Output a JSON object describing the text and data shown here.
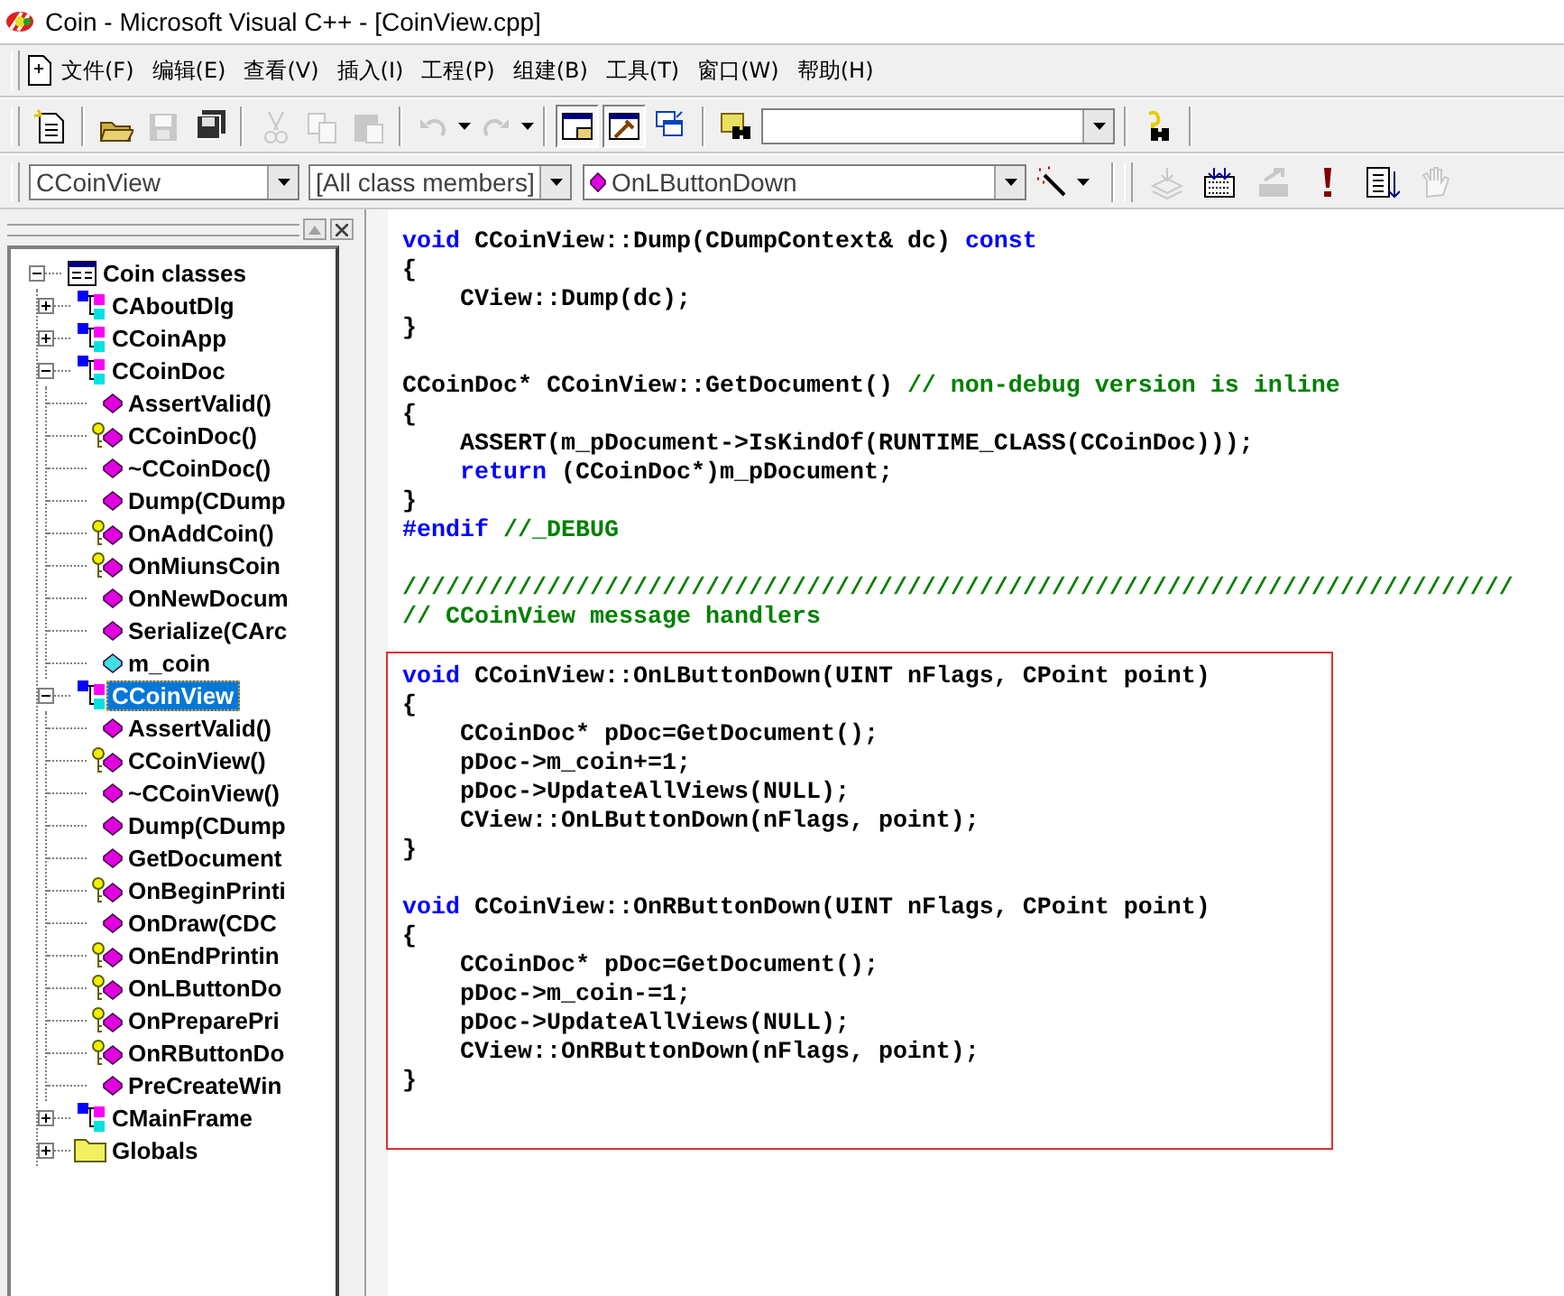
{
  "window": {
    "title": "Coin - Microsoft Visual C++ - [CoinView.cpp]"
  },
  "menu": [
    {
      "label": "文件(F)"
    },
    {
      "label": "编辑(E)"
    },
    {
      "label": "查看(V)"
    },
    {
      "label": "插入(I)"
    },
    {
      "label": "工程(P)"
    },
    {
      "label": "组建(B)"
    },
    {
      "label": "工具(T)"
    },
    {
      "label": "窗口(W)"
    },
    {
      "label": "帮助(H)"
    }
  ],
  "toolbar": [
    {
      "kind": "new",
      "disabled": false,
      "pressed": false
    },
    {
      "kind": "sep"
    },
    {
      "kind": "open",
      "disabled": false,
      "pressed": false
    },
    {
      "kind": "save",
      "disabled": true,
      "pressed": false
    },
    {
      "kind": "saveall",
      "disabled": false,
      "pressed": false
    },
    {
      "kind": "sep"
    },
    {
      "kind": "cut",
      "disabled": true,
      "pressed": false
    },
    {
      "kind": "copy",
      "disabled": true,
      "pressed": false
    },
    {
      "kind": "paste",
      "disabled": true,
      "pressed": false
    },
    {
      "kind": "sep"
    },
    {
      "kind": "undo",
      "disabled": true,
      "pressed": false
    },
    {
      "kind": "redo",
      "disabled": true,
      "pressed": false
    },
    {
      "kind": "sep"
    },
    {
      "kind": "workspace",
      "disabled": false,
      "pressed": true
    },
    {
      "kind": "output",
      "disabled": false,
      "pressed": true
    },
    {
      "kind": "windows",
      "disabled": false,
      "pressed": false
    },
    {
      "kind": "sep"
    },
    {
      "kind": "findfiles",
      "disabled": false,
      "pressed": false
    },
    {
      "kind": "combo"
    },
    {
      "kind": "sep"
    },
    {
      "kind": "helpfind",
      "disabled": false,
      "pressed": false
    }
  ],
  "wizard_bar": {
    "class_combo": "CCoinView",
    "filter_combo": "[All class members]",
    "member_combo": "OnLButtonDown"
  },
  "build_toolbar": [
    {
      "kind": "compile",
      "disabled": true
    },
    {
      "kind": "build",
      "disabled": false
    },
    {
      "kind": "stop",
      "disabled": true
    },
    {
      "kind": "execute",
      "disabled": false
    },
    {
      "kind": "go",
      "disabled": false
    },
    {
      "kind": "breakpoint",
      "disabled": true
    }
  ],
  "class_tree": {
    "children": [
      {
        "label": "Coin classes",
        "kind": "classes",
        "expanded": true,
        "selected": false,
        "children": [
          {
            "label": "CAboutDlg",
            "kind": "class",
            "expanded": false,
            "selected": false
          },
          {
            "label": "CCoinApp",
            "kind": "class",
            "expanded": false,
            "selected": false
          },
          {
            "label": "CCoinDoc",
            "kind": "class",
            "expanded": true,
            "selected": false,
            "children": [
              {
                "label": "AssertValid()",
                "kind": "method",
                "selected": false
              },
              {
                "label": "CCoinDoc()",
                "kind": "protected",
                "selected": false
              },
              {
                "label": "~CCoinDoc()",
                "kind": "method",
                "selected": false
              },
              {
                "label": "Dump(CDump",
                "kind": "method",
                "selected": false
              },
              {
                "label": "OnAddCoin()",
                "kind": "protected",
                "selected": false
              },
              {
                "label": "OnMiunsCoin",
                "kind": "protected",
                "selected": false
              },
              {
                "label": "OnNewDocum",
                "kind": "method",
                "selected": false
              },
              {
                "label": "Serialize(CArc",
                "kind": "method",
                "selected": false
              },
              {
                "label": "m_coin",
                "kind": "variable",
                "selected": false
              }
            ]
          },
          {
            "label": "CCoinView",
            "kind": "class",
            "expanded": true,
            "selected": true,
            "children": [
              {
                "label": "AssertValid()",
                "kind": "method",
                "selected": false
              },
              {
                "label": "CCoinView()",
                "kind": "protected",
                "selected": false
              },
              {
                "label": "~CCoinView()",
                "kind": "method",
                "selected": false
              },
              {
                "label": "Dump(CDump",
                "kind": "method",
                "selected": false
              },
              {
                "label": "GetDocument",
                "kind": "method",
                "selected": false
              },
              {
                "label": "OnBeginPrinti",
                "kind": "protected",
                "selected": false
              },
              {
                "label": "OnDraw(CDC",
                "kind": "method",
                "selected": false
              },
              {
                "label": "OnEndPrintin",
                "kind": "protected",
                "selected": false
              },
              {
                "label": "OnLButtonDo",
                "kind": "protected",
                "selected": false
              },
              {
                "label": "OnPreparePri",
                "kind": "protected",
                "selected": false
              },
              {
                "label": "OnRButtonDo",
                "kind": "protected",
                "selected": false
              },
              {
                "label": "PreCreateWin",
                "kind": "method",
                "selected": false
              }
            ]
          },
          {
            "label": "CMainFrame",
            "kind": "class",
            "expanded": false,
            "selected": false
          },
          {
            "label": "Globals",
            "kind": "folder",
            "expanded": false,
            "selected": false
          }
        ]
      }
    ]
  },
  "editor": {
    "lines": [
      {
        "kind": "code",
        "segments": [
          {
            "kind": "keyword",
            "text": "void"
          },
          {
            "kind": "plain",
            "text": " CCoinView::Dump(CDumpContext& dc) "
          },
          {
            "kind": "keyword",
            "text": "const"
          }
        ]
      },
      {
        "kind": "code",
        "segments": [
          {
            "kind": "plain",
            "text": "{"
          }
        ]
      },
      {
        "kind": "code",
        "segments": [
          {
            "kind": "plain",
            "text": "    CView::Dump(dc);"
          }
        ]
      },
      {
        "kind": "code",
        "segments": [
          {
            "kind": "plain",
            "text": "}"
          }
        ]
      },
      {
        "kind": "blank"
      },
      {
        "kind": "code",
        "segments": [
          {
            "kind": "plain",
            "text": "CCoinDoc* CCoinView::GetDocument() "
          },
          {
            "kind": "comment",
            "text": "// non-debug version is inline"
          }
        ]
      },
      {
        "kind": "code",
        "segments": [
          {
            "kind": "plain",
            "text": "{"
          }
        ]
      },
      {
        "kind": "code",
        "segments": [
          {
            "kind": "plain",
            "text": "    ASSERT(m_pDocument->IsKindOf(RUNTIME_CLASS(CCoinDoc)));"
          }
        ]
      },
      {
        "kind": "code",
        "segments": [
          {
            "kind": "keyword",
            "text": "    return"
          },
          {
            "kind": "plain",
            "text": " (CCoinDoc*)m_pDocument;"
          }
        ]
      },
      {
        "kind": "code",
        "segments": [
          {
            "kind": "plain",
            "text": "}"
          }
        ]
      },
      {
        "kind": "code",
        "segments": [
          {
            "kind": "keyword",
            "text": "#endif"
          },
          {
            "kind": "comment",
            "text": " //_DEBUG"
          }
        ]
      },
      {
        "kind": "blank"
      },
      {
        "kind": "code",
        "segments": [
          {
            "kind": "comment",
            "text": "/////////////////////////////////////////////////////////////////////////////"
          }
        ]
      },
      {
        "kind": "code",
        "segments": [
          {
            "kind": "comment",
            "text": "// CCoinView message handlers"
          }
        ]
      }
    ],
    "framed_lines": [
      {
        "kind": "code",
        "segments": [
          {
            "kind": "keyword",
            "text": "void"
          },
          {
            "kind": "plain",
            "text": " CCoinView::OnLButtonDown(UINT nFlags, CPoint point)"
          }
        ]
      },
      {
        "kind": "code",
        "segments": [
          {
            "kind": "plain",
            "text": "{"
          }
        ]
      },
      {
        "kind": "code",
        "segments": [
          {
            "kind": "plain",
            "text": "    CCoinDoc* pDoc=GetDocument();"
          }
        ]
      },
      {
        "kind": "code",
        "segments": [
          {
            "kind": "plain",
            "text": "    pDoc->m_coin+=1;"
          }
        ]
      },
      {
        "kind": "code",
        "segments": [
          {
            "kind": "plain",
            "text": "    pDoc->UpdateAllViews(NULL);"
          }
        ]
      },
      {
        "kind": "code",
        "segments": [
          {
            "kind": "plain",
            "text": "    CView::OnLButtonDown(nFlags, point);"
          }
        ]
      },
      {
        "kind": "code",
        "segments": [
          {
            "kind": "plain",
            "text": "}"
          }
        ]
      },
      {
        "kind": "blank"
      },
      {
        "kind": "code",
        "segments": [
          {
            "kind": "keyword",
            "text": "void"
          },
          {
            "kind": "plain",
            "text": " CCoinView::OnRButtonDown(UINT nFlags, CPoint point)"
          }
        ]
      },
      {
        "kind": "code",
        "segments": [
          {
            "kind": "plain",
            "text": "{"
          }
        ]
      },
      {
        "kind": "code",
        "segments": [
          {
            "kind": "plain",
            "text": "    CCoinDoc* pDoc=GetDocument();"
          }
        ]
      },
      {
        "kind": "code",
        "segments": [
          {
            "kind": "plain",
            "text": "    pDoc->m_coin-=1;"
          }
        ]
      },
      {
        "kind": "code",
        "segments": [
          {
            "kind": "plain",
            "text": "    pDoc->UpdateAllViews(NULL);"
          }
        ]
      },
      {
        "kind": "code",
        "segments": [
          {
            "kind": "plain",
            "text": "    CView::OnRButtonDown(nFlags, point);"
          }
        ]
      },
      {
        "kind": "code",
        "segments": [
          {
            "kind": "plain",
            "text": "}"
          }
        ]
      }
    ]
  }
}
